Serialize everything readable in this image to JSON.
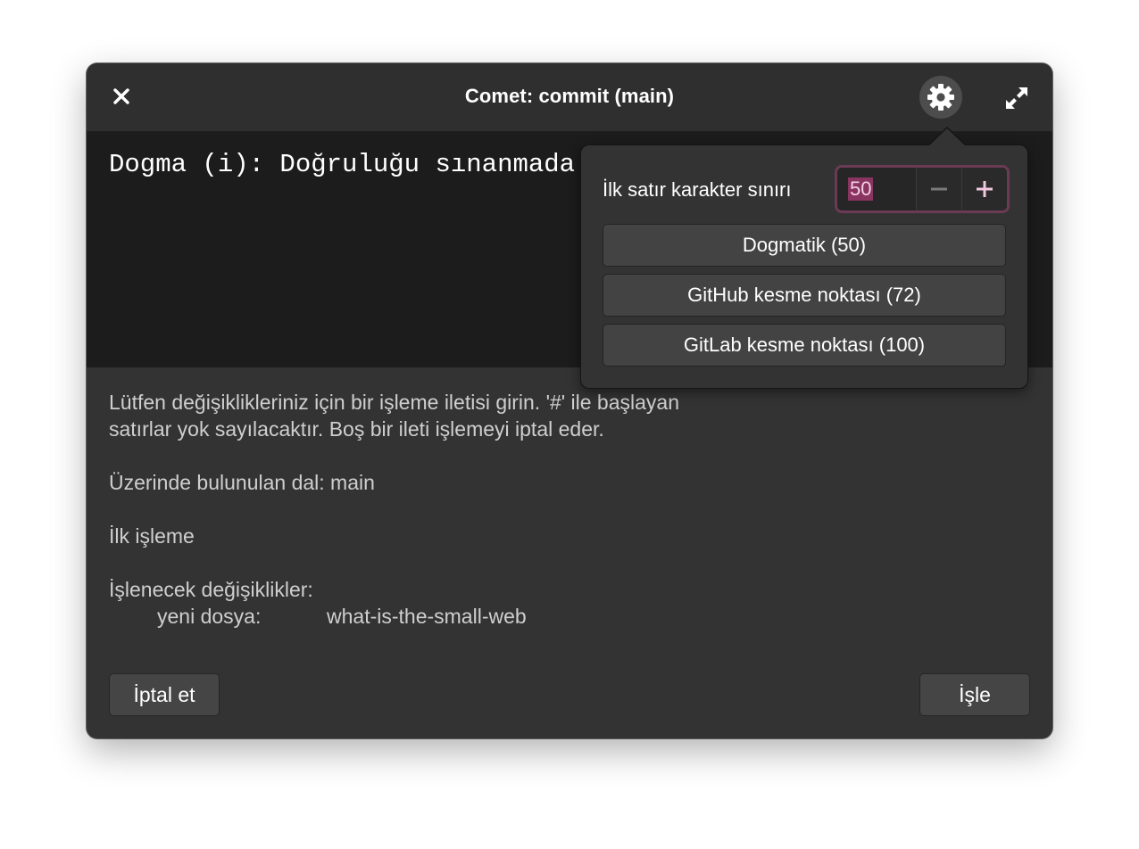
{
  "window": {
    "title": "Comet: commit (main)"
  },
  "editor": {
    "text": "Dogma (i): Doğruluğu sınanmada"
  },
  "comment": {
    "line1": "Lütfen değişiklikleriniz için bir işleme iletisi girin. '#' ile başlayan",
    "line2": "satırlar yok sayılacaktır. Boş bir ileti işlemeyi iptal eder.",
    "branch": "Üzerinde bulunulan dal: main",
    "first_commit": "İlk işleme",
    "changes_header": "İşlenecek değişiklikler:",
    "file_label": "yeni dosya:",
    "file_name": "what-is-the-small-web"
  },
  "buttons": {
    "cancel": "İptal et",
    "commit": "İşle"
  },
  "popover": {
    "limit_label": "İlk satır karakter sınırı",
    "limit_value": "50",
    "presets": [
      {
        "label": "Dogmatik (50)"
      },
      {
        "label": "GitHub kesme noktası (72)"
      },
      {
        "label": "GitLab kesme noktası (100)"
      }
    ]
  },
  "icons": {
    "close": "close-icon",
    "settings": "gear-icon",
    "maximize": "maximize-icon",
    "decrement": "minus-icon",
    "increment": "plus-icon"
  },
  "colors": {
    "accent": "#8a3462",
    "accent_text": "#f4d0e4",
    "window_bg": "#333333",
    "editor_bg": "#1c1c1c"
  }
}
